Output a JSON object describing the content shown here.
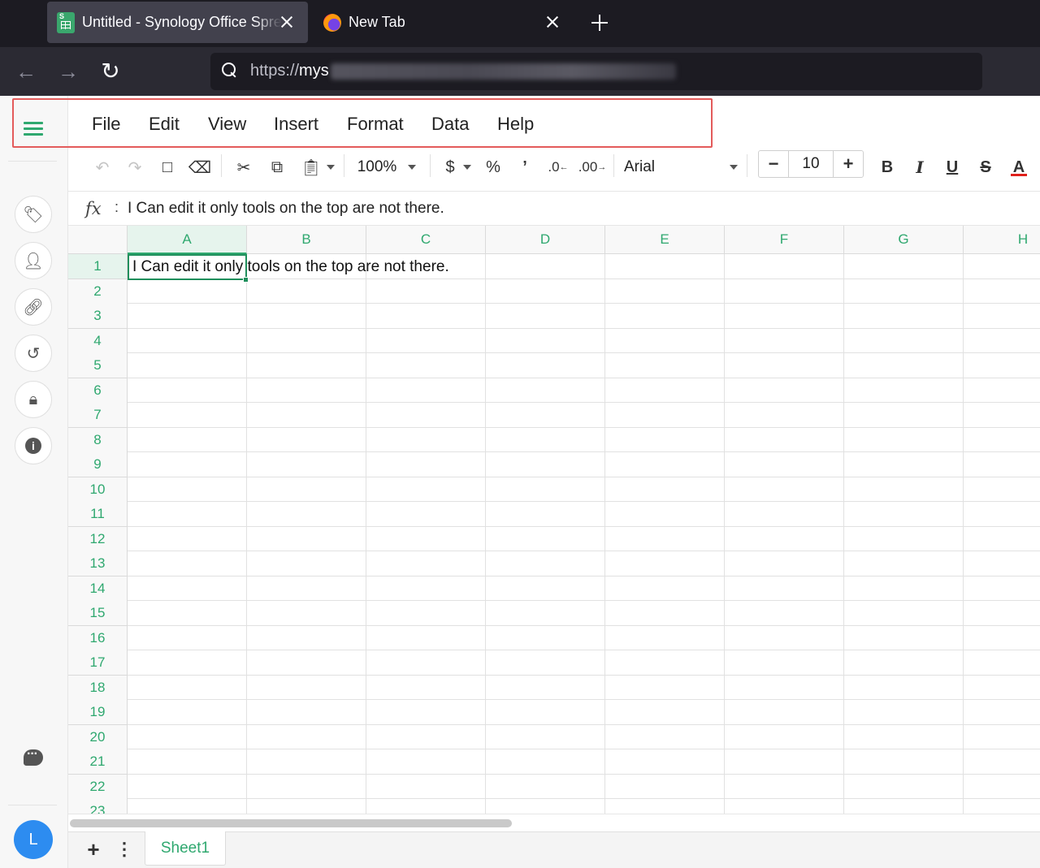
{
  "browser": {
    "tabs": [
      {
        "title": "Untitled - Synology Office Spreadsheet",
        "icon": "synology-sheets-icon",
        "active": true
      },
      {
        "title": "New Tab",
        "icon": "firefox-icon",
        "active": false
      }
    ],
    "url": {
      "protocol": "https://",
      "host_visible": "mys"
    }
  },
  "menu": {
    "items": [
      "File",
      "Edit",
      "View",
      "Insert",
      "Format",
      "Data",
      "Help"
    ]
  },
  "toolbar": {
    "zoom": "100%",
    "currency_symbol": "$",
    "percent_symbol": "%",
    "comma_symbol": "’",
    "decrease_decimal": ".0",
    "increase_decimal": ".00",
    "font": "Arial",
    "font_size": "10",
    "minus": "−",
    "plus": "+",
    "bold": "B",
    "italic": "I",
    "underline": "U",
    "strikethrough": "S",
    "font_color": "A"
  },
  "formula_bar": {
    "label": "fx",
    "colon": ":",
    "content": "I Can edit it only tools on the top are not there."
  },
  "grid": {
    "columns": [
      "A",
      "B",
      "C",
      "D",
      "E",
      "F",
      "G",
      "H"
    ],
    "rows": [
      "1",
      "2",
      "3",
      "4",
      "5",
      "6",
      "7",
      "8",
      "9",
      "10",
      "11",
      "12",
      "13",
      "14",
      "15",
      "16",
      "17",
      "18",
      "19",
      "20",
      "21",
      "22",
      "23"
    ],
    "selected_cell": "A1",
    "cells": {
      "A1": "I Can edit it only tools on the top are not there."
    }
  },
  "sheets": {
    "tabs": [
      "Sheet1"
    ],
    "active": "Sheet1"
  },
  "user": {
    "avatar_initial": "L"
  },
  "colors": {
    "accent": "#2fa86f",
    "annotation": "#e35b5b",
    "avatar": "#2d8cf0"
  }
}
